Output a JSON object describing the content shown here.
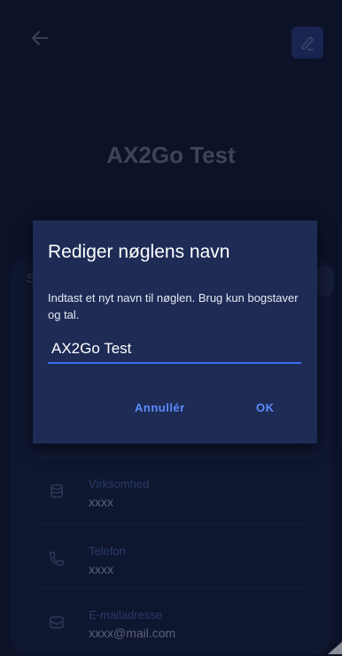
{
  "header": {
    "title": "AX2Go Test",
    "back_icon": "arrow-left-icon",
    "edit_icon": "pencil-icon"
  },
  "card": {
    "section_initial": "S"
  },
  "details": [
    {
      "icon": "database-icon",
      "label": "Virksomhed",
      "value": "xxxx"
    },
    {
      "icon": "phone-icon",
      "label": "Telefon",
      "value": "xxxx"
    },
    {
      "icon": "mail-icon",
      "label": "E-mailadresse",
      "value": "xxxx@mail.com"
    }
  ],
  "dialog": {
    "title": "Rediger nøglens navn",
    "message": "Indtast et nyt navn til nøglen. Brug kun bogstaver og tal.",
    "input_value": "AX2Go Test",
    "cancel_label": "Annullér",
    "ok_label": "OK"
  },
  "colors": {
    "background": "#0c1328",
    "dialog": "#1e2b55",
    "accent": "#5b8cff"
  }
}
